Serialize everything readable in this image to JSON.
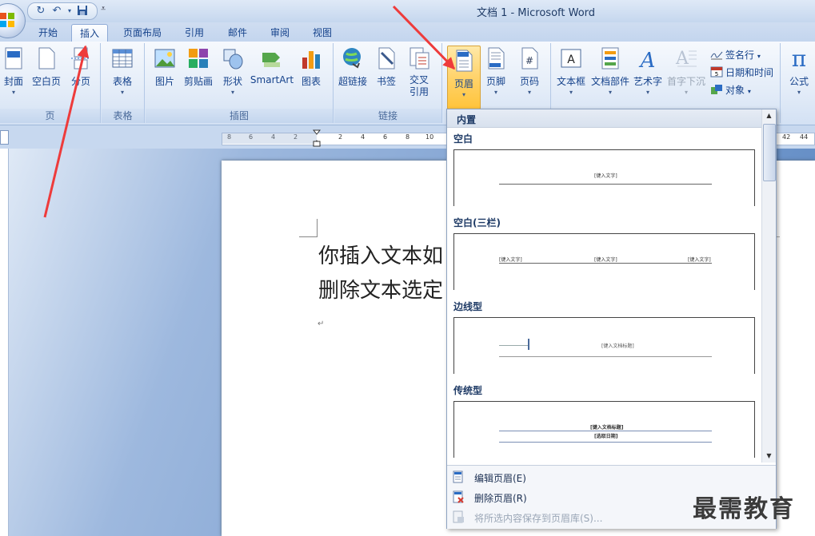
{
  "window": {
    "title": "文档 1 - Microsoft Word"
  },
  "tabs": [
    {
      "label": "开始"
    },
    {
      "label": "插入",
      "active": true
    },
    {
      "label": "页面布局"
    },
    {
      "label": "引用"
    },
    {
      "label": "邮件"
    },
    {
      "label": "审阅"
    },
    {
      "label": "视图"
    }
  ],
  "ribbon": {
    "pages": {
      "label": "页",
      "cover": "封面",
      "blank_page": "空白页",
      "page_break": "分页"
    },
    "tables": {
      "label": "表格",
      "table": "表格"
    },
    "illustrations": {
      "label": "插图",
      "picture": "图片",
      "clipart": "剪贴画",
      "shapes": "形状",
      "smartart": "SmartArt",
      "chart": "图表"
    },
    "links": {
      "label": "链接",
      "hyperlink": "超链接",
      "bookmark": "书签",
      "crossref_1": "交叉",
      "crossref_2": "引用"
    },
    "header_footer": {
      "header": "页眉",
      "footer": "页脚",
      "page_number": "页码"
    },
    "text": {
      "textbox": "文本框",
      "quickparts": "文档部件",
      "wordart": "艺术字",
      "dropcap": "首字下沉",
      "signature": "签名行",
      "datetime": "日期和时间",
      "object": "对象"
    },
    "symbols": {
      "equation": "公式"
    }
  },
  "ruler": {
    "numbers": [
      "8",
      "6",
      "4",
      "2",
      "2",
      "4",
      "6",
      "8",
      "10",
      "42",
      "44"
    ]
  },
  "document": {
    "line1": "你插入文本如",
    "line2": "删除文本选定",
    "para_mark": "↵"
  },
  "header_gallery": {
    "heading": "内置",
    "sections": [
      {
        "title": "空白",
        "placeholders": [
          "[键入文字]"
        ]
      },
      {
        "title": "空白(三栏)",
        "placeholders": [
          "[键入文字]",
          "[键入文字]",
          "[键入文字]"
        ]
      },
      {
        "title": "边线型",
        "placeholders": [
          "[键入文档标题]"
        ]
      },
      {
        "title": "传统型",
        "placeholders": [
          "[键入文档标题]",
          "[选取日期]"
        ]
      }
    ],
    "menu": [
      {
        "label": "编辑页眉(E)",
        "enabled": true
      },
      {
        "label": "删除页眉(R)",
        "enabled": true
      },
      {
        "label": "将所选内容保存到页眉库(S)...",
        "enabled": false
      }
    ]
  },
  "watermark": "最需教育",
  "colors": {
    "accent": "#15428b",
    "highlight": "#ffd36b",
    "arrow": "#ee3b3b"
  }
}
